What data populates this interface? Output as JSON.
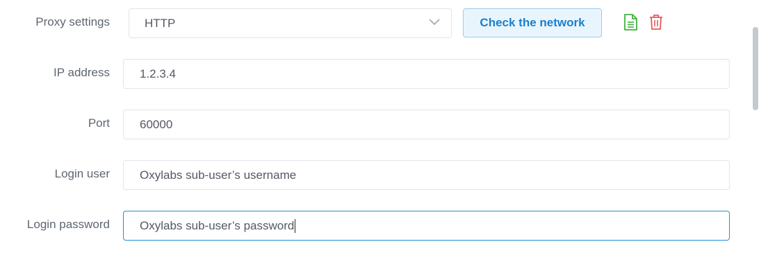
{
  "proxy": {
    "label": "Proxy settings",
    "selected": "HTTP",
    "check_button": "Check the network"
  },
  "fields": {
    "ip": {
      "label": "IP address",
      "value": "1.2.3.4"
    },
    "port": {
      "label": "Port",
      "value": "60000"
    },
    "user": {
      "label": "Login user",
      "value": "Oxylabs sub-user’s username"
    },
    "password": {
      "label": "Login password",
      "value": "Oxylabs sub-user’s password"
    }
  },
  "icons": {
    "save": "document-icon",
    "delete": "trash-icon"
  },
  "colors": {
    "accent": "#1a7fcd",
    "save_icon": "#3fb33f",
    "delete_icon": "#e8555a"
  }
}
